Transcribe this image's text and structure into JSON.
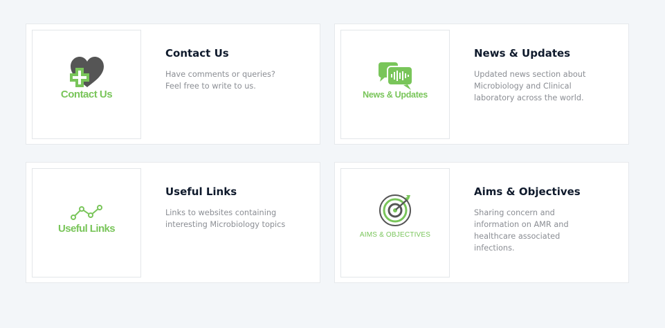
{
  "cards": [
    {
      "title": "Contact Us",
      "description": "Have comments or queries? Feel free to write to us.",
      "logo_text": "Contact Us",
      "icon": "heart-plus-icon"
    },
    {
      "title": "News & Updates",
      "description": "Updated news section about Microbiology and Clinical laboratory across the world.",
      "logo_text": "News & Updates",
      "icon": "chat-bubbles-icon"
    },
    {
      "title": "Useful Links",
      "description": "Links to websites containing interesting Microbiology topics",
      "logo_text": "Useful Links",
      "icon": "line-graph-icon"
    },
    {
      "title": "Aims & Objectives",
      "description": "Sharing concern and information on AMR and healthcare associated infections.",
      "logo_text": "AIMS & OBJECTIVES",
      "icon": "target-arrow-icon"
    }
  ],
  "colors": {
    "page_background": "#f3f6f9",
    "accent_green": "#79c55a",
    "icon_gray": "#555555",
    "title": "#0f1a2c",
    "text": "#8a8d93"
  }
}
